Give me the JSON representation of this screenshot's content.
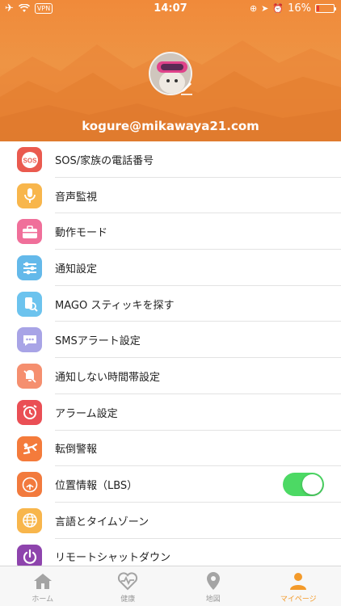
{
  "status_bar": {
    "time": "14:07",
    "vpn": "VPN",
    "battery": "16%",
    "battery_level": 0.16
  },
  "profile": {
    "email": "kogure@mikawaya21.com"
  },
  "menu": [
    {
      "label": "SOS/家族の電話番号",
      "icon": "sos-icon",
      "color": "#ea5a4f",
      "icon_text": "SOS"
    },
    {
      "label": "音声監視",
      "icon": "microphone-icon",
      "color": "#f8b64c"
    },
    {
      "label": "動作モード",
      "icon": "briefcase-icon",
      "color": "#f06f9a"
    },
    {
      "label": "通知設定",
      "icon": "sliders-icon",
      "color": "#64b9ea"
    },
    {
      "label": "MAGO スティッキを探す",
      "icon": "search-device-icon",
      "color": "#6cc3ee"
    },
    {
      "label": "SMSアラート設定",
      "icon": "chat-bubble-icon",
      "color": "#a8a4e6"
    },
    {
      "label": "通知しない時間帯設定",
      "icon": "bell-off-icon",
      "color": "#f58f6f"
    },
    {
      "label": "アラーム設定",
      "icon": "alarm-clock-icon",
      "color": "#ea4f55"
    },
    {
      "label": "転倒警報",
      "icon": "fall-person-icon",
      "color": "#f47b3b"
    },
    {
      "label": "位置情報（LBS）",
      "icon": "location-signal-icon",
      "color": "#f27a3d",
      "toggle": true
    },
    {
      "label": "言語とタイムゾーン",
      "icon": "globe-icon",
      "color": "#f8b64c"
    },
    {
      "label": "リモートシャットダウン",
      "icon": "power-icon",
      "color": "#8e44ad"
    }
  ],
  "tabbar": [
    {
      "label": "ホーム",
      "icon": "home-icon",
      "active": false
    },
    {
      "label": "健康",
      "icon": "heart-rate-icon",
      "active": false
    },
    {
      "label": "地図",
      "icon": "map-pin-icon",
      "active": false
    },
    {
      "label": "マイページ",
      "icon": "person-icon",
      "active": true
    }
  ],
  "colors": {
    "accent": "#f39a2a",
    "toggle_on": "#4cd964",
    "header": "#ef8d3e"
  }
}
